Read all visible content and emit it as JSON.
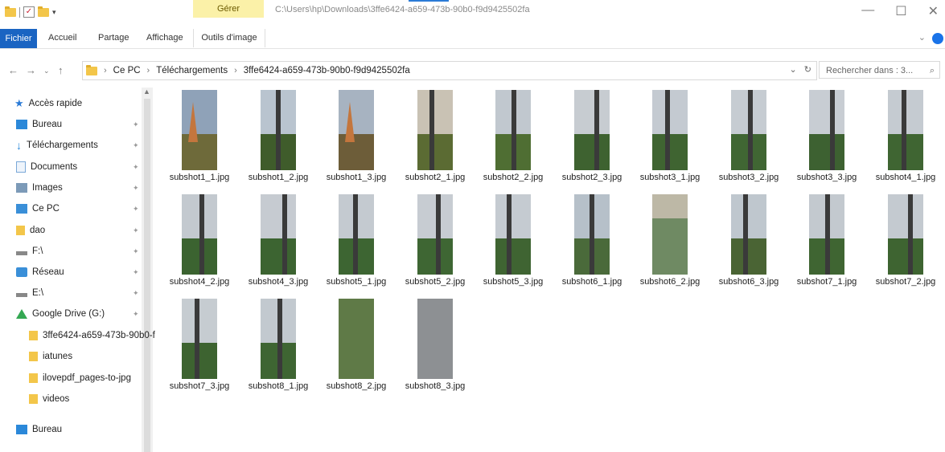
{
  "titlebar": {
    "manage_tab": "Gérer",
    "path": "C:\\Users\\hp\\Downloads\\3ffe6424-a659-473b-90b0-f9d9425502fa",
    "minimize_icon": "minimize-icon",
    "maximize_icon": "maximize-icon",
    "close_icon": "close-icon"
  },
  "ribbon": {
    "tabs": [
      "Fichier",
      "Accueil",
      "Partage",
      "Affichage",
      "Outils d'image"
    ]
  },
  "address": {
    "crumbs": [
      "Ce PC",
      "Téléchargements",
      "3ffe6424-a659-473b-90b0-f9d9425502fa"
    ],
    "search_placeholder": "Rechercher dans : 3..."
  },
  "sidebar": {
    "items": [
      {
        "label": "Accès rapide",
        "icon": "star-icon"
      },
      {
        "label": "Bureau",
        "icon": "desktop-icon",
        "pinned": true
      },
      {
        "label": "Téléchargements",
        "icon": "download-icon",
        "pinned": true
      },
      {
        "label": "Documents",
        "icon": "document-icon",
        "pinned": true
      },
      {
        "label": "Images",
        "icon": "images-icon",
        "pinned": true
      },
      {
        "label": "Ce PC",
        "icon": "computer-icon",
        "pinned": true
      },
      {
        "label": "dao",
        "icon": "folder-icon",
        "pinned": true
      },
      {
        "label": "F:\\",
        "icon": "drive-icon",
        "pinned": true
      },
      {
        "label": "Réseau",
        "icon": "network-icon",
        "pinned": true
      },
      {
        "label": "E:\\",
        "icon": "drive-icon",
        "pinned": true
      },
      {
        "label": "Google Drive (G:)",
        "icon": "google-drive-icon",
        "pinned": true
      },
      {
        "label": "3ffe6424-a659-473b-90b0-f",
        "icon": "folder-icon"
      },
      {
        "label": "iatunes",
        "icon": "folder-icon"
      },
      {
        "label": "ilovepdf_pages-to-jpg",
        "icon": "folder-icon"
      },
      {
        "label": "videos",
        "icon": "folder-icon"
      },
      {
        "label": "Bureau",
        "icon": "desktop-icon"
      }
    ]
  },
  "files": [
    {
      "name": "subshot1_1.jpg",
      "style": "church",
      "sky": "#8fa2b8",
      "ground": "#6e6a3a"
    },
    {
      "name": "subshot1_2.jpg",
      "style": "pole",
      "sky": "#b9c4cf",
      "ground": "#3f5c2b"
    },
    {
      "name": "subshot1_3.jpg",
      "style": "church",
      "sky": "#a7b3c1",
      "ground": "#6d5d39"
    },
    {
      "name": "subshot2_1.jpg",
      "style": "pole",
      "sky": "#c9c2b4",
      "ground": "#5b6b33"
    },
    {
      "name": "subshot2_2.jpg",
      "style": "pole",
      "sky": "#c1c8cf",
      "ground": "#4f6e33"
    },
    {
      "name": "subshot2_3.jpg",
      "style": "pole",
      "sky": "#c7ccd1",
      "ground": "#3e6230"
    },
    {
      "name": "subshot3_1.jpg",
      "style": "pole",
      "sky": "#c4cad1",
      "ground": "#3f6431"
    },
    {
      "name": "subshot3_2.jpg",
      "style": "pole",
      "sky": "#c6ccd2",
      "ground": "#406633"
    },
    {
      "name": "subshot3_3.jpg",
      "style": "pole",
      "sky": "#c8cdd3",
      "ground": "#3d6131"
    },
    {
      "name": "subshot4_1.jpg",
      "style": "pole",
      "sky": "#c5cbd1",
      "ground": "#3f6532"
    },
    {
      "name": "subshot4_2.jpg",
      "style": "pole",
      "sky": "#c3c9cf",
      "ground": "#3b6330"
    },
    {
      "name": "subshot4_3.jpg",
      "style": "pole",
      "sky": "#c6cbd1",
      "ground": "#3c6431"
    },
    {
      "name": "subshot5_1.jpg",
      "style": "pole",
      "sky": "#c4cad0",
      "ground": "#3d6532"
    },
    {
      "name": "subshot5_2.jpg",
      "style": "pole",
      "sky": "#c7ccd2",
      "ground": "#3e6633"
    },
    {
      "name": "subshot5_3.jpg",
      "style": "pole",
      "sky": "#c5cbd1",
      "ground": "#3f6432"
    },
    {
      "name": "subshot6_1.jpg",
      "style": "pole",
      "sky": "#b6c0c9",
      "ground": "#4a6a3a"
    },
    {
      "name": "subshot6_2.jpg",
      "style": "field",
      "sky": "#bdb8a6",
      "ground": "#6f8a63"
    },
    {
      "name": "subshot6_3.jpg",
      "style": "pole",
      "sky": "#bfc7ce",
      "ground": "#4a6434"
    },
    {
      "name": "subshot7_1.jpg",
      "style": "pole",
      "sky": "#c3c9cf",
      "ground": "#3f6532"
    },
    {
      "name": "subshot7_2.jpg",
      "style": "pole",
      "sky": "#c4cad0",
      "ground": "#3e6431"
    },
    {
      "name": "subshot7_3.jpg",
      "style": "pole",
      "sky": "#c6ccd1",
      "ground": "#3d6330"
    },
    {
      "name": "subshot8_1.jpg",
      "style": "pole",
      "sky": "#c2c9cf",
      "ground": "#3e6532"
    },
    {
      "name": "subshot8_2.jpg",
      "style": "blur",
      "sky": "#5f7a47",
      "ground": "#7f9863"
    },
    {
      "name": "subshot8_3.jpg",
      "style": "blur",
      "sky": "#8d9093",
      "ground": "#808387"
    }
  ]
}
